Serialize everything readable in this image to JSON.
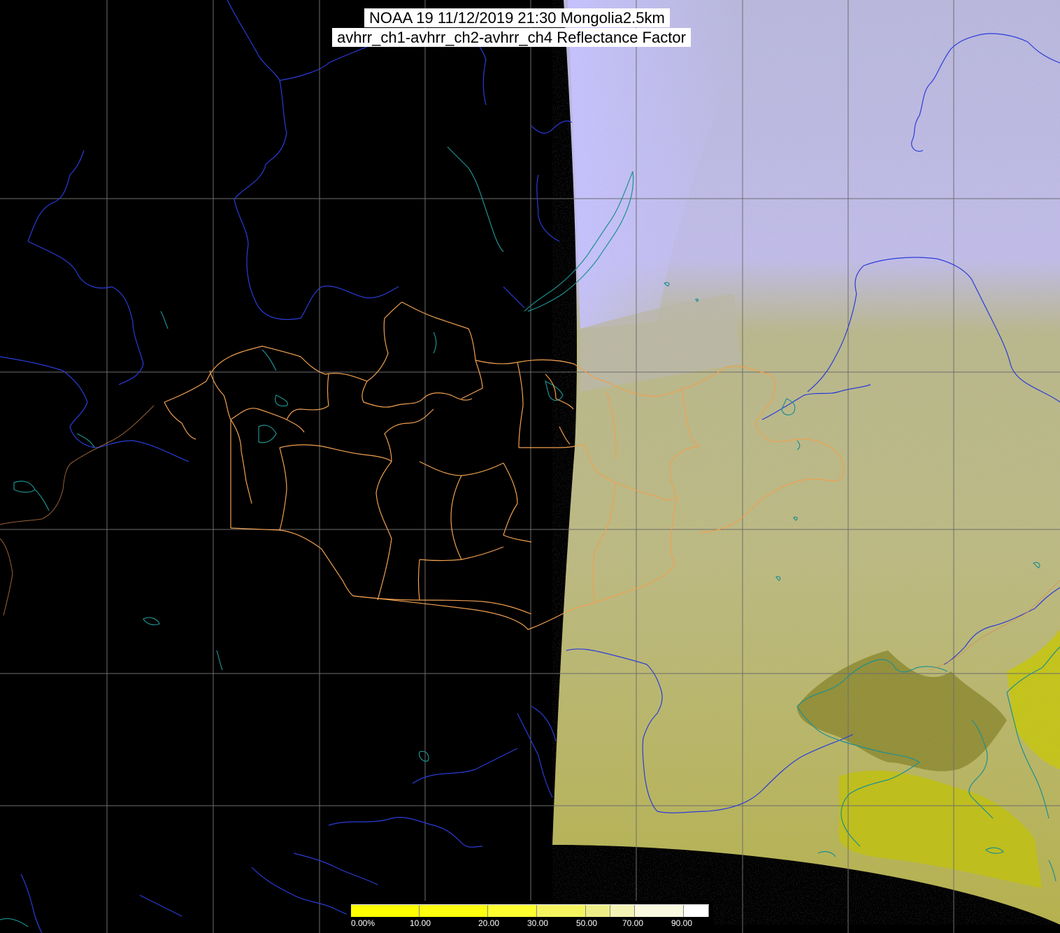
{
  "title": {
    "line1": "NOAA 19 11/12/2019 21:30 Mongolia2.5km",
    "line2": "avhrr_ch1-avhrr_ch2-avhrr_ch4 Reflectance Factor"
  },
  "colorbar": {
    "labels": [
      "0.00%",
      "10.00",
      "20.00",
      "30.00",
      "50.00",
      "70.00",
      "90.00"
    ],
    "colors": [
      "#ffff00",
      "#ffff10",
      "#ffff30",
      "#f5f560",
      "#eeee88",
      "#f4f4b4",
      "#fafae0",
      "#ffffff"
    ]
  },
  "map": {
    "background_color": "#000000",
    "graticule_color": "#6e6e6e",
    "river_color": "#2a3cd8",
    "lake_coast_color": "#1e8f8f",
    "border_color": "#f0a050",
    "night_side": "left",
    "day_side_colors": {
      "cloud": "#c4c0f4",
      "steppe": "#b8b67a",
      "plain": "#9a9838",
      "sea": "#c0c020"
    }
  }
}
